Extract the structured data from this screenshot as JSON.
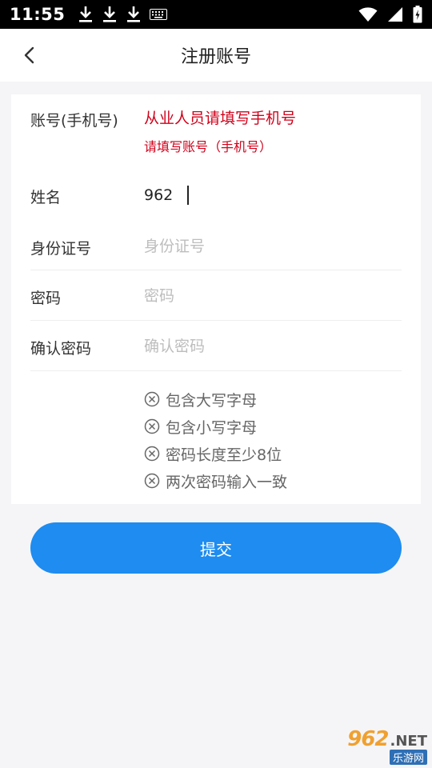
{
  "status_bar": {
    "time": "11:55",
    "left_icons": [
      "download-icon",
      "download-icon",
      "download-icon",
      "keyboard-icon"
    ],
    "right_icons": [
      "wifi-icon",
      "signal-icon",
      "battery-charging-icon"
    ]
  },
  "nav": {
    "title": "注册账号",
    "back_icon": "chevron-left-icon"
  },
  "form": {
    "account": {
      "label": "账号(手机号)",
      "placeholder": "从业人员请填写手机号",
      "error": "请填写账号（手机号）"
    },
    "name": {
      "label": "姓名",
      "value": "962"
    },
    "id_number": {
      "label": "身份证号",
      "placeholder": "身份证号"
    },
    "password": {
      "label": "密码",
      "placeholder": "密码"
    },
    "confirm_password": {
      "label": "确认密码",
      "placeholder": "确认密码"
    },
    "rules": [
      {
        "text": "包含大写字母",
        "icon": "circle-x-icon"
      },
      {
        "text": "包含小写字母",
        "icon": "circle-x-icon"
      },
      {
        "text": "密码长度至少8位",
        "icon": "circle-x-icon"
      },
      {
        "text": "两次密码输入一致",
        "icon": "circle-x-icon"
      }
    ]
  },
  "submit": {
    "label": "提交"
  },
  "watermark": {
    "number": "962",
    "suffix": ".NET",
    "subtitle": "乐游网"
  },
  "colors": {
    "primary": "#1e8cf0",
    "error": "#d0021b",
    "background": "#f5f5f7"
  }
}
